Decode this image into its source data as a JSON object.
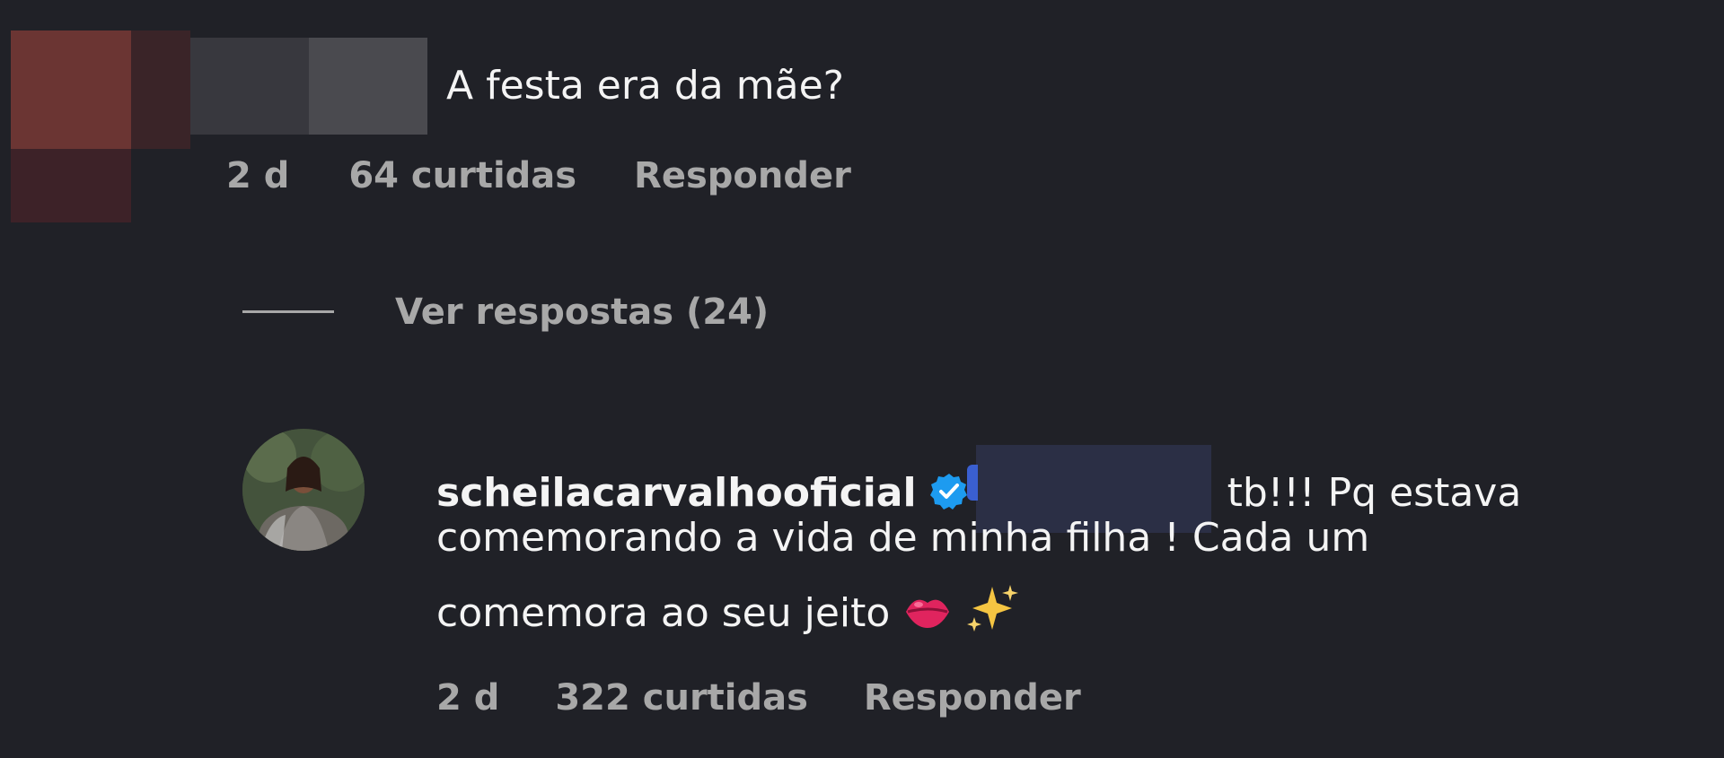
{
  "comment1": {
    "text": "A festa era da mãe?",
    "time": "2 d",
    "likes": "64 curtidas",
    "reply_label": "Responder"
  },
  "replies_toggle": {
    "label": "Ver respostas (24)"
  },
  "comment2": {
    "username": "scheilacarvalhooficial",
    "verified": true,
    "line1_text": "tb!!! Pq estava",
    "line2_text": "comemorando a vida de minha filha ! Cada um",
    "line3_text": "comemora ao seu jeito",
    "emojis": [
      "kiss-mark-icon",
      "sparkles-icon"
    ],
    "time": "2 d",
    "likes": "322 curtidas",
    "reply_label": "Responder"
  },
  "colors": {
    "background": "#202127",
    "text_primary": "#f4f4f4",
    "text_secondary": "#a8a8a8",
    "verified_blue": "#1d9bf0",
    "kiss_pink": "#e0245e",
    "sparkle_gold": "#f5c542"
  }
}
